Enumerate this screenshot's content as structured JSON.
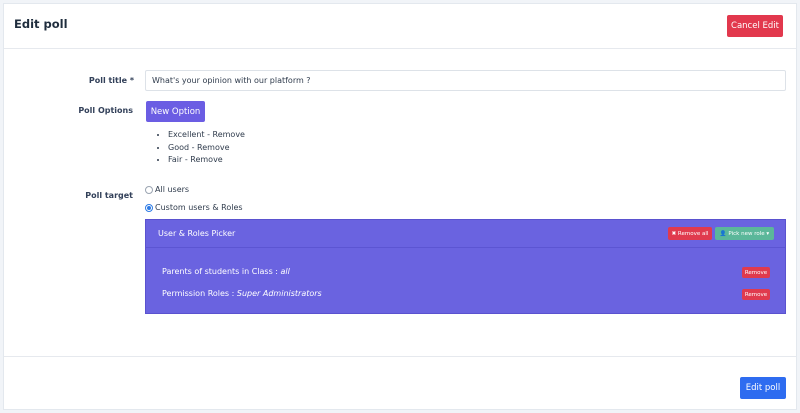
{
  "header": {
    "title": "Edit poll",
    "cancel_label": "Cancel Edit"
  },
  "form": {
    "poll_title_label": "Poll title *",
    "poll_title_value": "What's your opinion with our platform ?",
    "poll_options_label": "Poll Options",
    "new_option_label": "New Option",
    "options": [
      "Excellent - Remove",
      "Good - Remove",
      "Fair - Remove"
    ],
    "poll_target_label": "Poll target",
    "target_all": "All users",
    "target_custom": "Custom users & Roles"
  },
  "picker": {
    "title": "User & Roles Picker",
    "remove_all": "✖ Remove all",
    "pick_new_role": "👤 Pick new role ▾",
    "rows": [
      {
        "prefix": "Parents of students in Class : ",
        "value": "all",
        "remove": "Remove"
      },
      {
        "prefix": "Permission Roles : ",
        "value": "Super Administrators",
        "remove": "Remove"
      }
    ]
  },
  "footer": {
    "submit_label": "Edit poll"
  },
  "colors": {
    "accent": "#6a63e0",
    "danger": "#e2384d",
    "primary": "#2e6cf0",
    "success": "#5bb79a"
  }
}
